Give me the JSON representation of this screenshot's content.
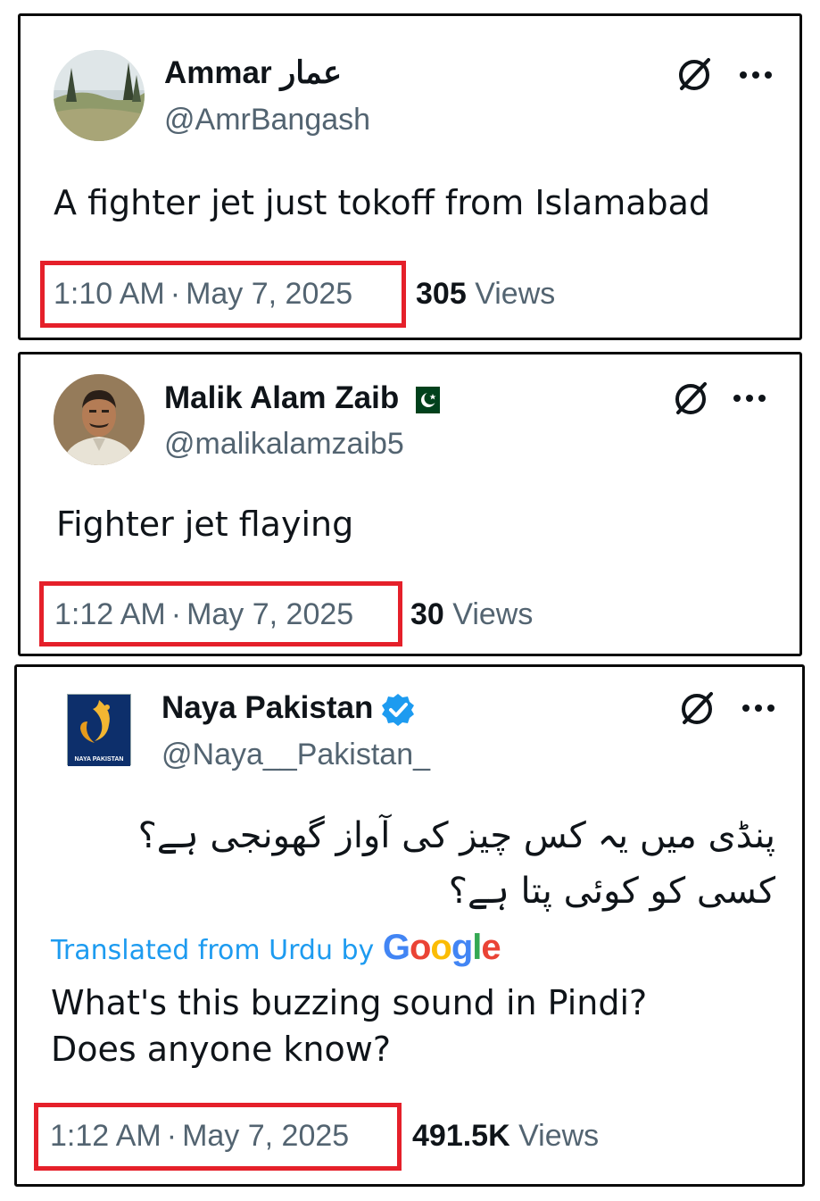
{
  "tweets": [
    {
      "display_name": "Ammar عمار",
      "handle": "@AmrBangash",
      "text": "A fighter jet just tokoff from Islamabad",
      "time": "1:10 AM",
      "date": "May 7, 2025",
      "views_count": "305",
      "views_label": "Views"
    },
    {
      "display_name": "Malik Alam Zaib",
      "handle": "@malikalamzaib5",
      "text": "Fighter jet flaying",
      "time": "1:12 AM",
      "date": "May 7, 2025",
      "views_count": "30",
      "views_label": "Views"
    },
    {
      "display_name": "Naya Pakistan",
      "handle": "@Naya__Pakistan_",
      "text_line1": "پنڈی میں یہ کس چیز کی آواز گھونجی ہے؟",
      "text_line2": "کسی کو کوئی پتا ہے؟",
      "translated_label": "Translated from Urdu by",
      "translated_by": "Google",
      "translation_line1": "What's this buzzing sound in Pindi?",
      "translation_line2": "Does anyone know?",
      "logo_text": "NAYA PAKISTAN",
      "time": "1:12 AM",
      "date": "May 7, 2025",
      "views_count": "491.5K",
      "views_label": "Views"
    }
  ],
  "separator": "·",
  "colors": {
    "highlight": "#e5202a",
    "secondary_text": "#536471",
    "verified": "#1d9bf0",
    "link": "#1d9bf0"
  },
  "icons": [
    "grok-icon",
    "more-options-icon",
    "pakistan-flag-icon",
    "verified-badge-icon"
  ]
}
